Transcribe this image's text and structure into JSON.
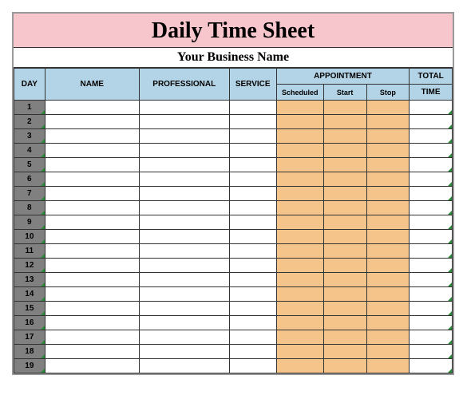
{
  "title": "Daily Time Sheet",
  "subtitle": "Your Business Name",
  "headers": {
    "day": "DAY",
    "name": "NAME",
    "professional": "PROFESSIONAL",
    "service": "SERVICE",
    "appointment": "APPOINTMENT",
    "scheduled": "Scheduled",
    "start": "Start",
    "stop": "Stop",
    "total": "TOTAL",
    "time": "TIME"
  },
  "rows": [
    {
      "day": "1",
      "name": "",
      "professional": "",
      "service": "",
      "scheduled": "",
      "start": "",
      "stop": "",
      "time": ""
    },
    {
      "day": "2",
      "name": "",
      "professional": "",
      "service": "",
      "scheduled": "",
      "start": "",
      "stop": "",
      "time": ""
    },
    {
      "day": "3",
      "name": "",
      "professional": "",
      "service": "",
      "scheduled": "",
      "start": "",
      "stop": "",
      "time": ""
    },
    {
      "day": "4",
      "name": "",
      "professional": "",
      "service": "",
      "scheduled": "",
      "start": "",
      "stop": "",
      "time": ""
    },
    {
      "day": "5",
      "name": "",
      "professional": "",
      "service": "",
      "scheduled": "",
      "start": "",
      "stop": "",
      "time": ""
    },
    {
      "day": "6",
      "name": "",
      "professional": "",
      "service": "",
      "scheduled": "",
      "start": "",
      "stop": "",
      "time": ""
    },
    {
      "day": "7",
      "name": "",
      "professional": "",
      "service": "",
      "scheduled": "",
      "start": "",
      "stop": "",
      "time": ""
    },
    {
      "day": "8",
      "name": "",
      "professional": "",
      "service": "",
      "scheduled": "",
      "start": "",
      "stop": "",
      "time": ""
    },
    {
      "day": "9",
      "name": "",
      "professional": "",
      "service": "",
      "scheduled": "",
      "start": "",
      "stop": "",
      "time": ""
    },
    {
      "day": "10",
      "name": "",
      "professional": "",
      "service": "",
      "scheduled": "",
      "start": "",
      "stop": "",
      "time": ""
    },
    {
      "day": "11",
      "name": "",
      "professional": "",
      "service": "",
      "scheduled": "",
      "start": "",
      "stop": "",
      "time": ""
    },
    {
      "day": "12",
      "name": "",
      "professional": "",
      "service": "",
      "scheduled": "",
      "start": "",
      "stop": "",
      "time": ""
    },
    {
      "day": "13",
      "name": "",
      "professional": "",
      "service": "",
      "scheduled": "",
      "start": "",
      "stop": "",
      "time": ""
    },
    {
      "day": "14",
      "name": "",
      "professional": "",
      "service": "",
      "scheduled": "",
      "start": "",
      "stop": "",
      "time": ""
    },
    {
      "day": "15",
      "name": "",
      "professional": "",
      "service": "",
      "scheduled": "",
      "start": "",
      "stop": "",
      "time": ""
    },
    {
      "day": "16",
      "name": "",
      "professional": "",
      "service": "",
      "scheduled": "",
      "start": "",
      "stop": "",
      "time": ""
    },
    {
      "day": "17",
      "name": "",
      "professional": "",
      "service": "",
      "scheduled": "",
      "start": "",
      "stop": "",
      "time": ""
    },
    {
      "day": "18",
      "name": "",
      "professional": "",
      "service": "",
      "scheduled": "",
      "start": "",
      "stop": "",
      "time": ""
    },
    {
      "day": "19",
      "name": "",
      "professional": "",
      "service": "",
      "scheduled": "",
      "start": "",
      "stop": "",
      "time": ""
    }
  ]
}
